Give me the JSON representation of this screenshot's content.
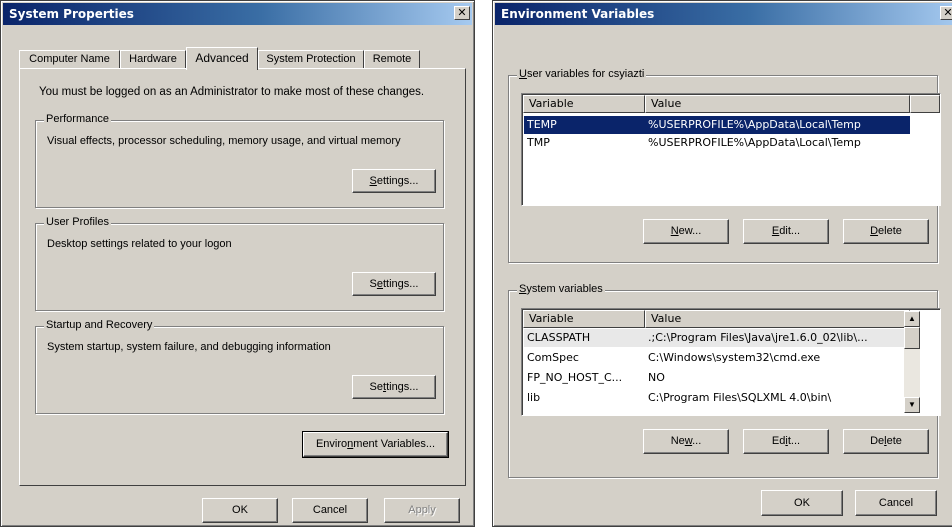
{
  "system_properties": {
    "title": "System Properties",
    "close_glyph": "✕",
    "tabs": [
      {
        "label": "Computer Name"
      },
      {
        "label": "Hardware"
      },
      {
        "label": "Advanced"
      },
      {
        "label": "System Protection"
      },
      {
        "label": "Remote"
      }
    ],
    "admin_note": "You must be logged on as an Administrator to make most of these changes.",
    "groups": {
      "performance": {
        "title": "Performance",
        "description": "Visual effects, processor scheduling, memory usage, and virtual memory",
        "button_pre": "",
        "button_key": "S",
        "button_post": "ettings..."
      },
      "user_profiles": {
        "title": "User Profiles",
        "description": "Desktop settings related to your logon",
        "button_pre": "S",
        "button_key": "e",
        "button_post": "ttings..."
      },
      "startup_recovery": {
        "title": "Startup and Recovery",
        "description": "System startup, system failure, and debugging information",
        "button_pre": "Se",
        "button_key": "t",
        "button_post": "tings..."
      }
    },
    "env_button": {
      "pre": "Enviro",
      "key": "n",
      "post": "ment Variables..."
    },
    "footer": {
      "ok": "OK",
      "cancel": "Cancel",
      "apply": "Apply"
    }
  },
  "environment_variables": {
    "title": "Environment Variables",
    "close_glyph": "✕",
    "user_section": {
      "key": "U",
      "title_rest": "ser variables for csyiazti",
      "columns": {
        "variable": "Variable",
        "value": "Value"
      },
      "rows": [
        {
          "variable": "TEMP",
          "value": "%USERPROFILE%\\AppData\\Local\\Temp",
          "selected": true
        },
        {
          "variable": "TMP",
          "value": "%USERPROFILE%\\AppData\\Local\\Temp",
          "selected": false
        }
      ],
      "buttons": {
        "new": {
          "key": "N",
          "post": "ew..."
        },
        "edit": {
          "key": "E",
          "post": "dit..."
        },
        "delete": {
          "key": "D",
          "post": "elete"
        }
      }
    },
    "system_section": {
      "key": "S",
      "title_rest": "ystem variables",
      "columns": {
        "variable": "Variable",
        "value": "Value"
      },
      "rows": [
        {
          "variable": "CLASSPATH",
          "value": ".;C:\\Program Files\\Java\\jre1.6.0_02\\lib\\..."
        },
        {
          "variable": "ComSpec",
          "value": "C:\\Windows\\system32\\cmd.exe"
        },
        {
          "variable": "FP_NO_HOST_C...",
          "value": "NO"
        },
        {
          "variable": "lib",
          "value": "C:\\Program Files\\SQLXML 4.0\\bin\\"
        }
      ],
      "buttons": {
        "new": {
          "pre": "Ne",
          "key": "w",
          "post": "..."
        },
        "edit": {
          "pre": "Ed",
          "key": "i",
          "post": "t..."
        },
        "delete": {
          "pre": "De",
          "key": "l",
          "post": "ete"
        }
      },
      "scroll_up": "▲",
      "scroll_down": "▼"
    },
    "footer": {
      "ok": "OK",
      "cancel": "Cancel"
    }
  }
}
